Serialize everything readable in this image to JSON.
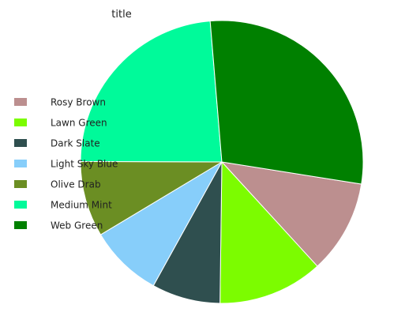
{
  "chart_data": {
    "type": "pie",
    "title": "title",
    "legend_position": "left",
    "series": [
      {
        "name": "Rosy Brown",
        "value": 10.5,
        "color": "#bc8f8f"
      },
      {
        "name": "Lawn Green",
        "value": 11.8,
        "color": "#7cfc00"
      },
      {
        "name": "Dark Slate",
        "value": 7.7,
        "color": "#2f4f4f"
      },
      {
        "name": "Light Sky Blue",
        "value": 8.2,
        "color": "#87cefa"
      },
      {
        "name": "Olive Drab",
        "value": 8.5,
        "color": "#6b8e23"
      },
      {
        "name": "Medium Mint",
        "value": 23.2,
        "color": "#00fa9a"
      },
      {
        "name": "Web Green",
        "value": 28.3,
        "color": "#008000"
      }
    ]
  }
}
